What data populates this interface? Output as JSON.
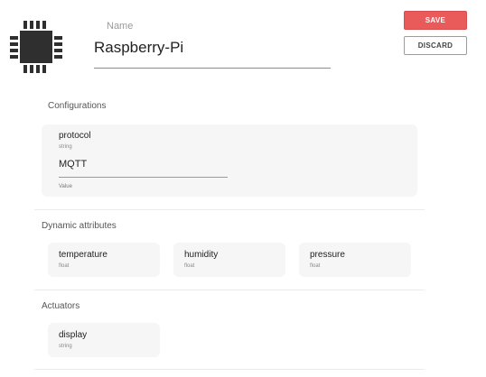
{
  "device": {
    "name_label": "Name",
    "name_value": "Raspberry-Pi",
    "icon": "chip-icon"
  },
  "actions": {
    "save_label": "SAVE",
    "discard_label": "DISCARD"
  },
  "configurations": {
    "title": "Configurations",
    "items": [
      {
        "name": "protocol",
        "type": "string",
        "value": "MQTT",
        "value_label": "Value"
      }
    ]
  },
  "dynamic_attributes": {
    "title": "Dynamic attributes",
    "items": [
      {
        "name": "temperature",
        "type": "float"
      },
      {
        "name": "humidity",
        "type": "float"
      },
      {
        "name": "pressure",
        "type": "float"
      }
    ]
  },
  "actuators": {
    "title": "Actuators",
    "items": [
      {
        "name": "display",
        "type": "string"
      }
    ]
  },
  "colors": {
    "accent": "#e95a5b",
    "card_background": "#f6f6f6"
  }
}
